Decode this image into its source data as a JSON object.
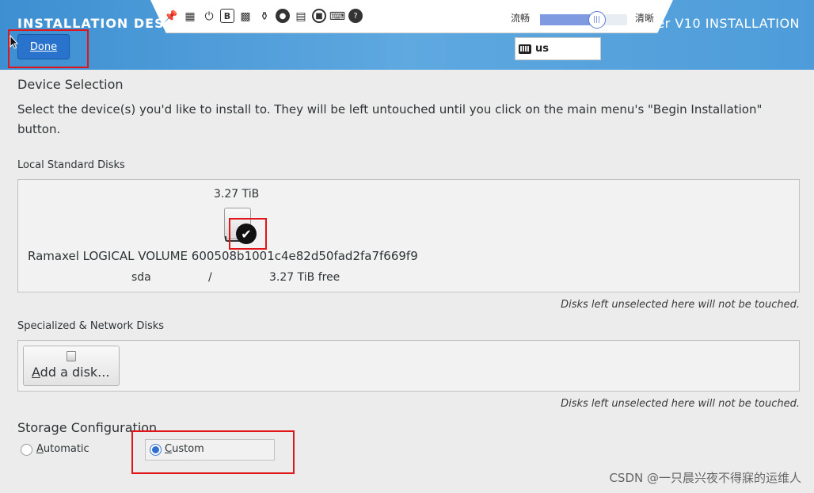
{
  "header": {
    "title_left": "INSTALLATION DESTI",
    "title_right": "ver V10 INSTALLATION",
    "done_label": "Done"
  },
  "toolbar": {
    "icons": [
      "pin-icon",
      "fit-screen-icon",
      "power-icon",
      "b-icon",
      "keyboard-combo-icon",
      "mount-icon",
      "disc-icon",
      "floppy-icon",
      "record-icon",
      "virtual-keyboard-icon",
      "help-icon"
    ],
    "quality_left": "流畅",
    "quality_right": "清晰",
    "quality_level": 0.65
  },
  "keyboard": {
    "layout": "us"
  },
  "device_selection": {
    "title": "Device Selection",
    "description_line1": "Select the device(s) you'd like to install to.  They will be left untouched until you click on the main menu's \"Begin Installation\"",
    "description_line2": "button."
  },
  "local_disks": {
    "heading": "Local Standard Disks",
    "disk": {
      "size": "3.27 TiB",
      "name": "Ramaxel LOGICAL VOLUME 600508b1001c4e82d50fad2fa7f669f9",
      "device": "sda",
      "separator": "/",
      "free": "3.27 TiB free",
      "selected": true
    },
    "note": "Disks left unselected here will not be touched."
  },
  "network_disks": {
    "heading": "Specialized & Network Disks",
    "add_label_underlined": "A",
    "add_label_rest": "dd a disk...",
    "note": "Disks left unselected here will not be touched."
  },
  "storage_configuration": {
    "heading": "Storage Configuration",
    "automatic_underlined": "A",
    "automatic_rest": "utomatic",
    "custom_underlined": "C",
    "custom_rest": "ustom",
    "selected": "Custom"
  },
  "watermark": "CSDN @一只晨兴夜不得寐的运维人"
}
